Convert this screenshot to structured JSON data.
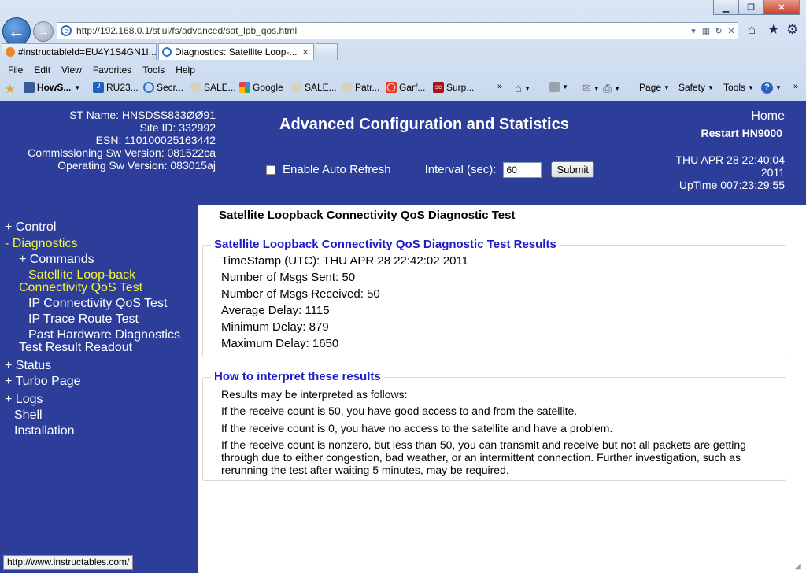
{
  "browser": {
    "address_url": "http://192.168.0.1/stlui/fs/advanced/sat_lpb_qos.html",
    "tabs": [
      {
        "label": "#instructableId=EU4Y1S4GN1I...",
        "active": false
      },
      {
        "label": "Diagnostics: Satellite Loop-...",
        "active": true
      }
    ],
    "menu": [
      "File",
      "Edit",
      "View",
      "Favorites",
      "Tools",
      "Help"
    ],
    "favorites": [
      "HowS...",
      "RU23...",
      "Secr...",
      "SALE...",
      "Google",
      "SALE...",
      "Patr...",
      "Garf...",
      "Surp..."
    ],
    "commands": [
      "Page",
      "Safety",
      "Tools"
    ],
    "status_url": "http://www.instructables.com/"
  },
  "header": {
    "st_name": "ST Name: HNSDSS833ØØ91",
    "site_id": "Site ID: 332992",
    "esn": "ESN: 110100025163442",
    "commissioning_sw": "Commissioning Sw Version: 081522ca",
    "operating_sw": "Operating Sw Version: 083015aj",
    "title": "Advanced Configuration and Statistics",
    "home": "Home",
    "restart": "Restart HN9000",
    "date": "THU APR 28 22:40:04",
    "year": "2011",
    "uptime": "UpTime 007:23:29:55",
    "auto_refresh_label": "Enable Auto Refresh",
    "interval_label": "Interval (sec):",
    "interval_value": "60",
    "submit_label": "Submit"
  },
  "sidebar": {
    "control": "+ Control",
    "diagnostics": "- Diagnostics",
    "commands": "+ Commands",
    "sat_loopback_1": "Satellite Loop-back",
    "sat_loopback_2": "Connectivity QoS Test",
    "ip_qos": "IP Connectivity QoS Test",
    "ip_trace": "IP Trace Route Test",
    "past_hw_1": "Past Hardware Diagnostics",
    "past_hw_2": "Test Result Readout",
    "status": "+ Status",
    "turbo": "+ Turbo Page",
    "logs": "+ Logs",
    "shell": "Shell",
    "installation": "Installation"
  },
  "main": {
    "heading": "Satellite Loopback Connectivity QoS Diagnostic Test",
    "results_legend": "Satellite Loopback Connectivity QoS Diagnostic Test Results",
    "results": [
      "TimeStamp (UTC): THU APR 28 22:42:02 2011",
      "Number of Msgs Sent: 50",
      "Number of Msgs Received: 50",
      "Average Delay: 1115",
      "Minimum Delay: 879",
      "Maximum Delay: 1650"
    ],
    "interpret_legend": "How to interpret these results",
    "interpret": [
      "Results may be interpreted as follows:",
      "If the receive count is 50, you have good access to and from the satellite.",
      "If the receive count is 0, you have no access to the satellite and have a problem.",
      "If the receive count is nonzero, but less than 50, you can transmit and receive but not all packets are getting through due to either congestion, bad weather, or an intermittent connection. Further investigation, such as rerunning the test after waiting 5 minutes, may be required."
    ]
  }
}
